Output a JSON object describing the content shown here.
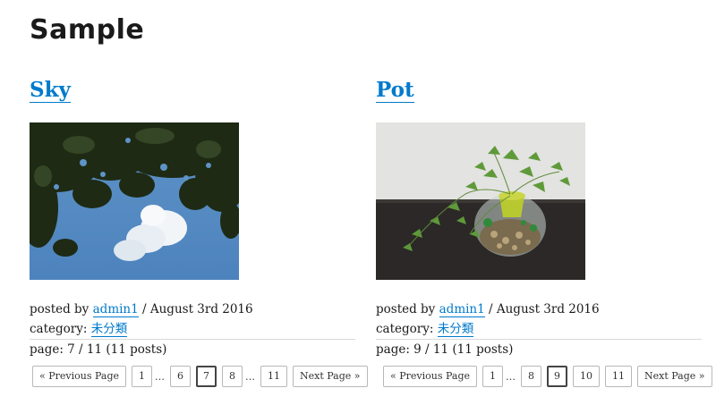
{
  "site": {
    "title": "Sample"
  },
  "posts": [
    {
      "title": "Sky",
      "image_alt": "sky-photo",
      "posted_by_prefix": "posted by",
      "author": "admin1",
      "date_sep": "/ August 3rd 2016",
      "category_label": "category:",
      "category": "未分類",
      "page_info": "page: 7 / 11 (11 posts)",
      "pager": {
        "prev": "« Previous Page",
        "next": "Next Page »",
        "items": [
          "1",
          "…",
          "6",
          "7",
          "8",
          "…",
          "11"
        ],
        "current": "7"
      }
    },
    {
      "title": "Pot",
      "image_alt": "pot-photo",
      "posted_by_prefix": "posted by",
      "author": "admin1",
      "date_sep": "/ August 3rd 2016",
      "category_label": "category:",
      "category": "未分類",
      "page_info": "page: 9 / 11 (11 posts)",
      "pager": {
        "prev": "« Previous Page",
        "next": "Next Page »",
        "items": [
          "1",
          "…",
          "8",
          "9",
          "10",
          "11"
        ],
        "current": "9"
      }
    }
  ],
  "colors": {
    "link": "#007acc",
    "text": "#1a1a1a"
  }
}
